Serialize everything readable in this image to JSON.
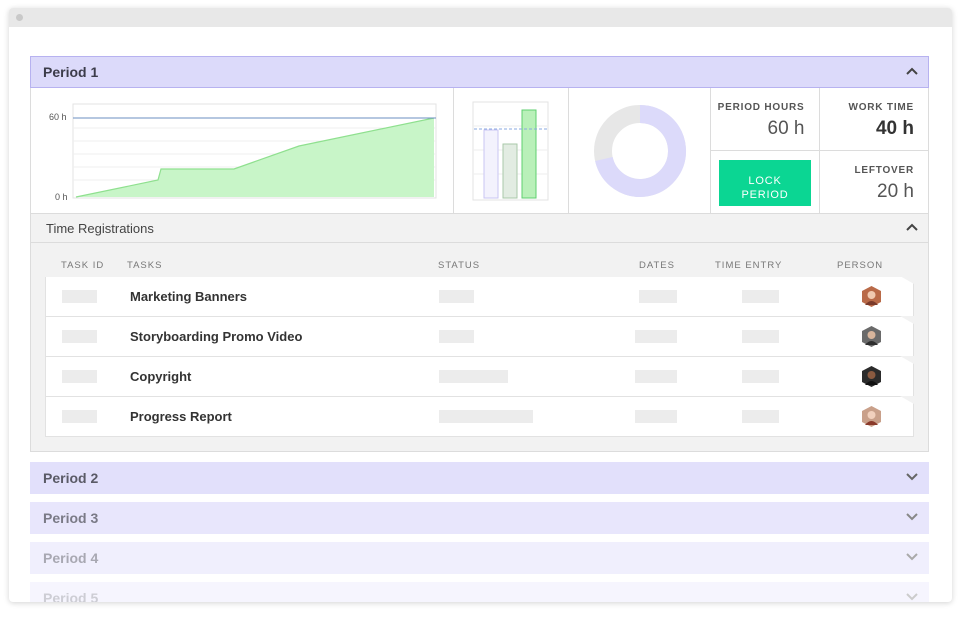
{
  "period1": {
    "title": "Period 1"
  },
  "area_chart": {
    "y_top": "60 h",
    "y_bottom": "0 h"
  },
  "metrics": {
    "period_hours_label": "PERIOD HOURS",
    "period_hours_value": "60 h",
    "work_time_label": "WORK TIME",
    "work_time_value": "40 h",
    "lock_button": "LOCK PERIOD",
    "leftover_label": "LEFTOVER",
    "leftover_value": "20 h"
  },
  "time_registrations": {
    "title": "Time Registrations",
    "columns": [
      "TASK ID",
      "TASKS",
      "STATUS",
      "DATES",
      "TIME ENTRY",
      "PERSON"
    ],
    "rows": [
      {
        "task": "Marketing Banners"
      },
      {
        "task": "Storyboarding Promo Video"
      },
      {
        "task": "Copyright"
      },
      {
        "task": "Progress Report"
      }
    ]
  },
  "periods": [
    {
      "title": "Period 2"
    },
    {
      "title": "Period 3"
    },
    {
      "title": "Period 4"
    },
    {
      "title": "Period 5"
    }
  ],
  "colors": {
    "period_header": "#dcdafa",
    "accent_green": "#0bd693",
    "donut_fill": "#dcdafa",
    "area_fill": "#c8f5c8"
  }
}
